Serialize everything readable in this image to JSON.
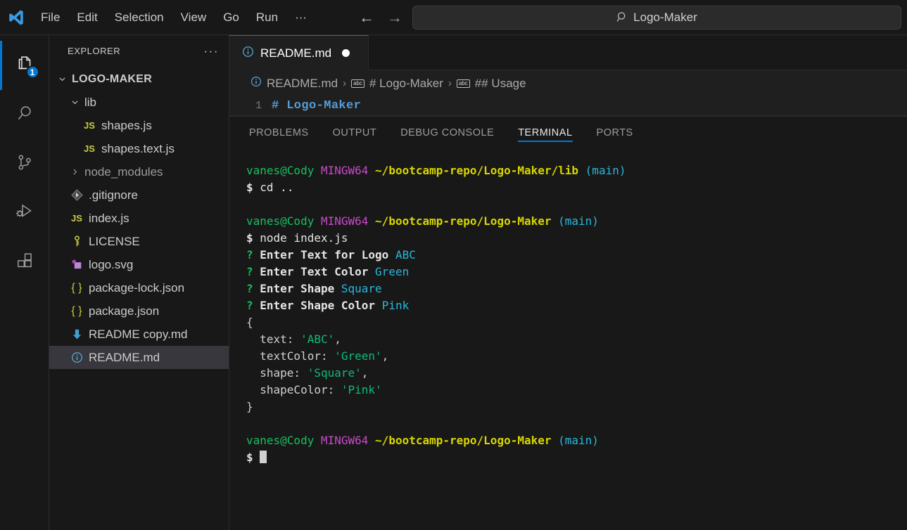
{
  "titlebar": {
    "logo_icon": "vscode-logo-icon",
    "menu": [
      {
        "label": "File"
      },
      {
        "label": "Edit"
      },
      {
        "label": "Selection"
      },
      {
        "label": "View"
      },
      {
        "label": "Go"
      },
      {
        "label": "Run"
      },
      {
        "label": "···"
      }
    ],
    "nav": {
      "back_icon": "arrow-left-icon",
      "forward_icon": "arrow-right-icon"
    },
    "search": {
      "icon": "search-icon",
      "value": "Logo-Maker"
    }
  },
  "activitybar": {
    "items": [
      {
        "name": "explorer",
        "icon": "files-icon",
        "active": true,
        "badge": "1"
      },
      {
        "name": "search",
        "icon": "search-icon",
        "active": false,
        "badge": ""
      },
      {
        "name": "source-control",
        "icon": "source-control-icon",
        "active": false,
        "badge": ""
      },
      {
        "name": "run-and-debug",
        "icon": "run-debug-icon",
        "active": false,
        "badge": ""
      },
      {
        "name": "extensions",
        "icon": "extensions-icon",
        "active": false,
        "badge": ""
      }
    ]
  },
  "sidebar": {
    "title": "EXPLORER",
    "more_icon": "ellipsis-icon",
    "root": {
      "label": "LOGO-MAKER",
      "chevron": "chevron-down-icon"
    },
    "items": [
      {
        "label": "lib",
        "icon": "folder-open-icon",
        "indent": 1,
        "chevron": "chevron-down-icon",
        "kind": "folder",
        "selected": false,
        "dim": false
      },
      {
        "label": "shapes.js",
        "icon": "js-file-icon",
        "indent": 2,
        "chevron": "",
        "kind": "js",
        "selected": false,
        "dim": false
      },
      {
        "label": "shapes.text.js",
        "icon": "js-file-icon",
        "indent": 2,
        "chevron": "",
        "kind": "js",
        "selected": false,
        "dim": false
      },
      {
        "label": "node_modules",
        "icon": "folder-icon",
        "indent": 1,
        "chevron": "chevron-right-icon",
        "kind": "folder",
        "selected": false,
        "dim": true
      },
      {
        "label": ".gitignore",
        "icon": "git-file-icon",
        "indent": 1,
        "chevron": "",
        "kind": "git",
        "selected": false,
        "dim": false
      },
      {
        "label": "index.js",
        "icon": "js-file-icon",
        "indent": 1,
        "chevron": "",
        "kind": "js",
        "selected": false,
        "dim": false
      },
      {
        "label": "LICENSE",
        "icon": "license-key-icon",
        "indent": 1,
        "chevron": "",
        "kind": "license",
        "selected": false,
        "dim": false
      },
      {
        "label": "logo.svg",
        "icon": "svg-file-icon",
        "indent": 1,
        "chevron": "",
        "kind": "svg",
        "selected": false,
        "dim": false
      },
      {
        "label": "package-lock.json",
        "icon": "json-file-icon",
        "indent": 1,
        "chevron": "",
        "kind": "json",
        "selected": false,
        "dim": false
      },
      {
        "label": "package.json",
        "icon": "json-file-icon",
        "indent": 1,
        "chevron": "",
        "kind": "json",
        "selected": false,
        "dim": false
      },
      {
        "label": "README copy.md",
        "icon": "markdown-file-icon",
        "indent": 1,
        "chevron": "",
        "kind": "mdcopy",
        "selected": false,
        "dim": false
      },
      {
        "label": "README.md",
        "icon": "info-file-icon",
        "indent": 1,
        "chevron": "",
        "kind": "md",
        "selected": true,
        "dim": false
      }
    ]
  },
  "editor": {
    "tab": {
      "icon": "info-file-icon",
      "label": "README.md",
      "dirty_icon": "unsaved-dot-icon"
    },
    "breadcrumb": {
      "file_icon": "info-file-icon",
      "parts": [
        {
          "label": "README.md",
          "icon": ""
        },
        {
          "label": "# Logo-Maker",
          "icon": "abc-symbol-icon"
        },
        {
          "label": "## Usage",
          "icon": "abc-symbol-icon"
        }
      ],
      "separator": "›"
    },
    "lines": [
      {
        "number": "1",
        "text": "# Logo-Maker"
      }
    ]
  },
  "panel": {
    "tabs": [
      {
        "label": "PROBLEMS",
        "active": false
      },
      {
        "label": "OUTPUT",
        "active": false
      },
      {
        "label": "DEBUG CONSOLE",
        "active": false
      },
      {
        "label": "TERMINAL",
        "active": true
      },
      {
        "label": "PORTS",
        "active": false
      }
    ],
    "terminal": {
      "lines": [
        {
          "type": "prompt",
          "user": "vanes@Cody",
          "shell": "MINGW64",
          "path": "~/bootcamp-repo/Logo-Maker/lib",
          "branch": "(main)"
        },
        {
          "type": "command",
          "sigil": "$",
          "text": "cd .."
        },
        {
          "type": "blank"
        },
        {
          "type": "prompt",
          "user": "vanes@Cody",
          "shell": "MINGW64",
          "path": "~/bootcamp-repo/Logo-Maker",
          "branch": "(main)"
        },
        {
          "type": "command",
          "sigil": "$",
          "text": "node index.js"
        },
        {
          "type": "question",
          "sigil": "?",
          "label": "Enter Text for Logo",
          "answer": "ABC"
        },
        {
          "type": "question",
          "sigil": "?",
          "label": "Enter Text Color",
          "answer": "Green"
        },
        {
          "type": "question",
          "sigil": "?",
          "label": "Enter Shape",
          "answer": "Square"
        },
        {
          "type": "question",
          "sigil": "?",
          "label": "Enter Shape Color",
          "answer": "Pink"
        },
        {
          "type": "brace",
          "text": "{"
        },
        {
          "type": "kv",
          "key": "text",
          "value": "'ABC'",
          "comma": ","
        },
        {
          "type": "kv",
          "key": "textColor",
          "value": "'Green'",
          "comma": ","
        },
        {
          "type": "kv",
          "key": "shape",
          "value": "'Square'",
          "comma": ","
        },
        {
          "type": "kv",
          "key": "shapeColor",
          "value": "'Pink'",
          "comma": ""
        },
        {
          "type": "brace",
          "text": "}"
        },
        {
          "type": "blank"
        },
        {
          "type": "prompt",
          "user": "vanes@Cody",
          "shell": "MINGW64",
          "path": "~/bootcamp-repo/Logo-Maker",
          "branch": "(main)"
        },
        {
          "type": "cursorline",
          "sigil": "$"
        }
      ]
    }
  },
  "colors": {
    "accent": "#0078d4",
    "terminal_green": "#17c05e",
    "terminal_magenta": "#c84ac8",
    "terminal_yellow": "#d6d600",
    "terminal_cyan": "#29b8db",
    "string_green": "#0dbc79",
    "background": "#1f1f1f",
    "chrome": "#181818"
  }
}
